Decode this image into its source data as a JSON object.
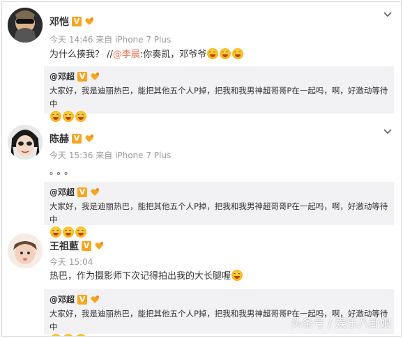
{
  "posts": [
    {
      "name": "邓恺",
      "meta": "今天 14:46 来自 iPhone 7 Plus",
      "content_text": "为什么揍我？ //",
      "mention": "@李晨",
      "content_after": ":你奏凯，邓爷爷",
      "emoji_count": 3,
      "quote_name": "@邓超",
      "quote_text": "大家好，我是迪丽热巴，能把其他五个人P掉，把我和我男神超哥哥P在一起吗，啊，好激动等待中"
    },
    {
      "name": "陈赫",
      "meta": "今天 15:36 来自 iPhone 7 Plus",
      "content_text": "。。。",
      "quote_name": "@邓超",
      "quote_text": "大家好，我是迪丽热巴，能把其他五个人P掉，把我和我男神超哥哥P在一起吗，啊，好激动等待中"
    },
    {
      "name": "王祖藍",
      "meta": "今天 15:04",
      "content_text": "热巴，作为摄影师下次记得拍出我的大长腿喔",
      "quote_name": "@邓超",
      "quote_text": "大家好，我是迪丽热巴，能把其他五个人P掉，把我和我男神超哥哥P在一起吗，啊，好激动等待中"
    }
  ],
  "badge_v": "V",
  "watermark": "头条号 / 娱乐八卦娘",
  "colors": {
    "mention": "#eb7350",
    "quote_bg": "#f2f2f5",
    "badge": "#f5a623"
  }
}
